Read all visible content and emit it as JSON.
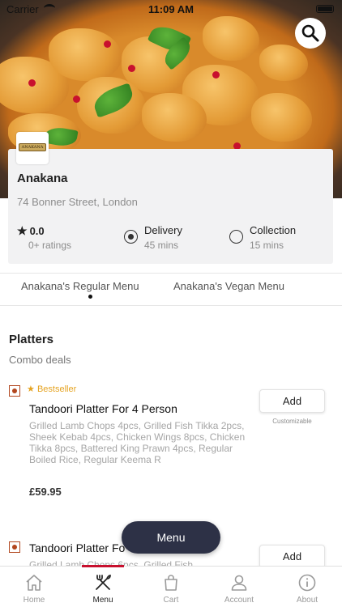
{
  "status_bar": {
    "carrier": "Carrier",
    "time": "11:09 AM"
  },
  "restaurant": {
    "logo_text": "ANAKANA",
    "name": "Anakana",
    "address": "74 Bonner Street, London",
    "rating": "0.0",
    "rating_count": "0+ ratings"
  },
  "order_options": [
    {
      "label": "Delivery",
      "time": "45 mins",
      "selected": true
    },
    {
      "label": "Collection",
      "time": "15 mins",
      "selected": false
    }
  ],
  "menu_tabs": [
    {
      "label": "Anakana's Regular Menu",
      "active": true
    },
    {
      "label": "Anakana's Vegan Menu",
      "active": false
    }
  ],
  "section": {
    "title": "Platters",
    "subtitle": "Combo deals"
  },
  "items": [
    {
      "badge": "Bestseller",
      "title": "Tandoori Platter For 4 Person",
      "description": "Grilled Lamb Chops 4pcs, Grilled Fish Tikka 2pcs, Sheek Kebab 4pcs, Chicken Wings 8pcs, Chicken Tikka 8pcs, Battered King Prawn 4pcs, Regular Boiled Rice, Regular Keema R",
      "price": "£59.95",
      "add_label": "Add",
      "note": "Customizable"
    },
    {
      "title": "Tandoori Platter Fo",
      "description": "Grilled Lamb Chops 6pcs, Grilled Fish",
      "add_label": "Add"
    }
  ],
  "floating_button": "Menu",
  "bottom_nav": [
    {
      "label": "Home",
      "icon": "home-icon",
      "active": false
    },
    {
      "label": "Menu",
      "icon": "cutlery-icon",
      "active": true
    },
    {
      "label": "Cart",
      "icon": "shopping-bag-icon",
      "active": false
    },
    {
      "label": "Account",
      "icon": "person-icon",
      "active": false
    },
    {
      "label": "About",
      "icon": "info-icon",
      "active": false
    }
  ],
  "colors": {
    "accent": "#c8102e",
    "nav_dark": "#2d3146",
    "veg_mark": "#b2471f",
    "bestseller": "#e5a321"
  }
}
